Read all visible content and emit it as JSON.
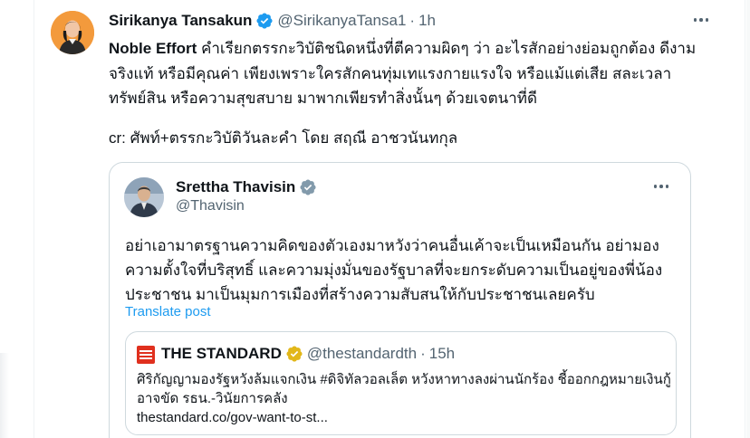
{
  "tweet": {
    "author_name": "Sirikanya Tansakun",
    "author_handle": "@SirikanyaTansa1",
    "separator": "·",
    "time": "1h",
    "body_bold": "Noble Effort",
    "body_text": " คำเรียกตรรกะวิบัติชนิดหนึ่งที่ตีความผิดๆ ว่า อะไรสักอย่างย่อมถูกต้อง ดีงาม จริงแท้ หรือมีคุณค่า เพียงเพราะใครสักคนทุ่มเทแรงกายแรงใจ หรือแม้แต่เสีย สละเวลา ทรัพย์สิน หรือความสุขสบาย มาพากเพียรทำสิ่งนั้นๆ ด้วยเจตนาที่ดี",
    "credit": "cr: ศัพท์+ตรรกะวิบัติวันละคำ โดย สฤณี อาชวนันทกุล"
  },
  "quoted_tweet": {
    "author_name": "Srettha Thavisin",
    "author_handle": "@Thavisin",
    "text": "อย่าเอามาตรฐานความคิดของตัวเองมาหวังว่าคนอื่นเค้าจะเป็นเหมือนกัน อย่ามองความตั้งใจที่บริสุทธิ์ และความมุ่งมั่นของรัฐบาลที่จะยกระดับความเป็นอยู่ของพี่น้องประชาชน มาเป็นมุมการเมืองที่สร้างความสับสนให้กับประชาชนเลยครับ",
    "translate_label": "Translate post"
  },
  "inner_quote": {
    "author_name": "THE STANDARD",
    "author_handle": "@thestandardth",
    "separator": "·",
    "time": "15h",
    "text": "ศิริกัญญามองรัฐหวังล้มแจกเงิน #ดิจิทัลวอลเล็ต หวังหาทางลงผ่านนักร้อง ชี้ออกกฎหมายเงินกู้อาจขัด รธน.-วินัยการคลัง",
    "link": "thestandard.co/gov-want-to-st..."
  },
  "icons": {
    "verified_blue": "verified-badge-icon",
    "verified_gray": "government-badge-icon",
    "verified_gold": "business-badge-icon",
    "more": "more-horizontal-icon"
  },
  "colors": {
    "accent": "#1d9bf0",
    "gray_badge": "#829aab",
    "gold_badge": "#e2b719",
    "standard_red": "#e0301e"
  }
}
